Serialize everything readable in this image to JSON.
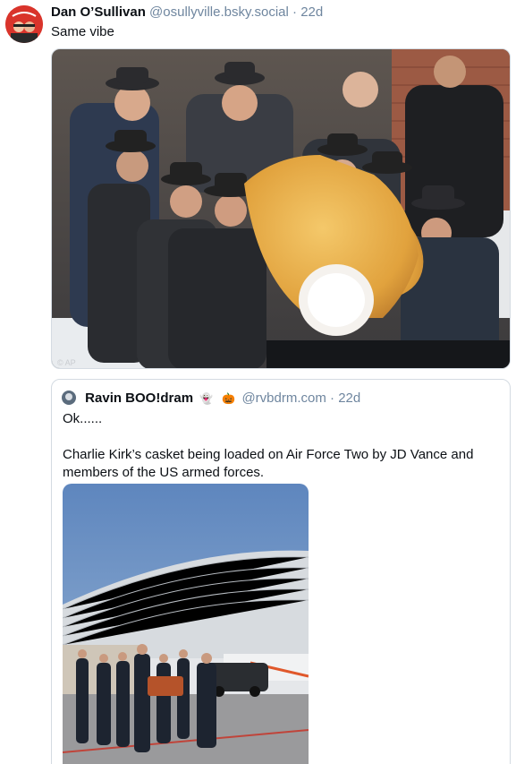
{
  "post": {
    "author_name": "Dan O’Sullivan",
    "author_handle": "@osullyville.bsky.social",
    "separator": "·",
    "time": "22d",
    "text": "Same vibe",
    "image_watermark": "© AP"
  },
  "quote": {
    "author_name": "Ravin BOO!dram",
    "name_emoji_1": "👻",
    "name_emoji_2": "🎃",
    "author_handle": "@rvbdrm.com",
    "separator": "·",
    "time": "22d",
    "text_line_1": "Ok......",
    "text_line_2": "Charlie Kirk’s casket being loaded on Air Force Two by JD Vance and members of the US armed forces."
  },
  "colors": {
    "muted": "#6f869f",
    "border": "#d4dbe2",
    "text": "#0b0f14"
  }
}
